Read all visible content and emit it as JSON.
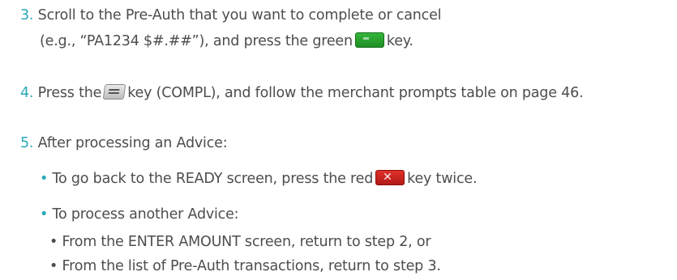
{
  "steps": [
    {
      "number": "3.",
      "line1": "Scroll to the Pre-Auth that you want to complete or cancel",
      "line2_before": "(e.g., “PA1234 $#.##”), and press the green",
      "line2_after": "key."
    },
    {
      "number": "4.",
      "before": "Press the",
      "after": "key (COMPL), and follow the merchant prompts table on page 46."
    },
    {
      "number": "5.",
      "text": "After processing an Advice:",
      "bullets": [
        {
          "before": "To go back to the READY screen, press the red",
          "after": "key twice."
        },
        {
          "text": "To process another Advice:",
          "sub_bullets": [
            "From the ENTER AMOUNT screen, return to step 2, or",
            "From the list of Pre-Auth transactions, return to step 3."
          ]
        }
      ]
    }
  ],
  "bullet_char": "•",
  "icons": {
    "green_key": "green-enter-key-icon",
    "gray_key": "gray-menu-key-icon",
    "red_key": "red-cancel-key-icon"
  },
  "colors": {
    "number": "#2aa8b8",
    "text": "#4d4d4f",
    "green_key": "#2ba531",
    "red_key": "#d0241f"
  }
}
